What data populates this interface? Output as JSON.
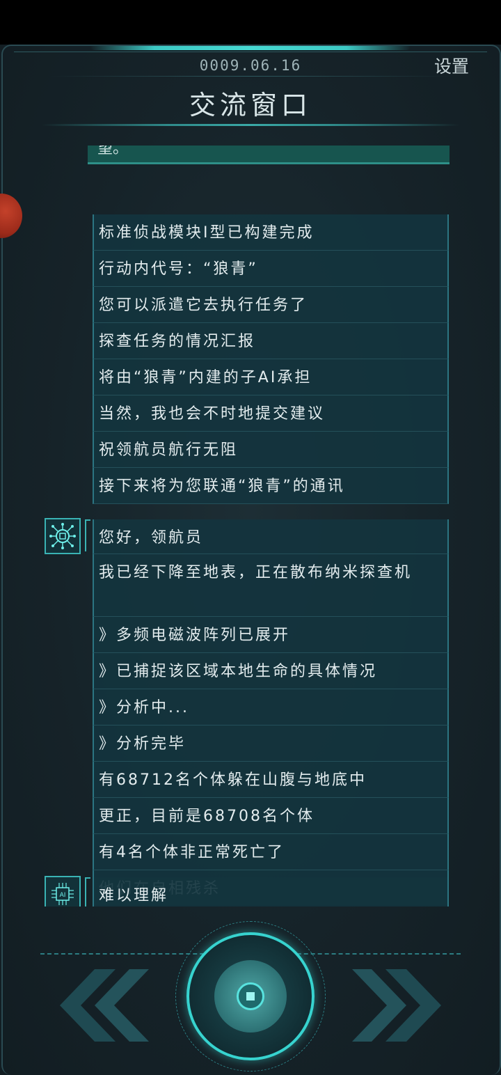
{
  "header": {
    "date": "0009.06.16",
    "title": "交流窗口",
    "settings_label": "设置"
  },
  "chat": {
    "cut_off_text": "望。",
    "group1": [
      "标准侦战模块I型已构建完成",
      "行动内代号：“狼青”",
      "您可以派遣它去执行任务了",
      "探查任务的情况汇报",
      "将由“狼青”内建的子AI承担",
      "当然，我也会不时地提交建议",
      "祝领航员航行无阻",
      "接下来将为您联通“狼青”的通讯"
    ],
    "group2": [
      "您好，领航员",
      "我已经下降至地表，正在散布纳米探查机",
      "》多频电磁波阵列已展开",
      "》已捕捉该区域本地生命的具体情况",
      "》分析中...",
      "》分析完毕",
      "有68712名个体躲在山腹与地底中",
      "更正，目前是68708名个体",
      "有4名个体非正常死亡了",
      "他们在自相残杀"
    ],
    "group3": [
      "难以理解"
    ],
    "avatar2_icon": "circuit-node-icon",
    "avatar3_icon": "ai-chip-icon",
    "avatar3_label": "AI"
  },
  "controls": {
    "prev_icon": "double-chevron-left-icon",
    "next_icon": "double-chevron-right-icon",
    "main_icon": "center-action-icon"
  },
  "colors": {
    "accent": "#37d3cf",
    "bubble": "#14343e",
    "background": "#162329"
  }
}
